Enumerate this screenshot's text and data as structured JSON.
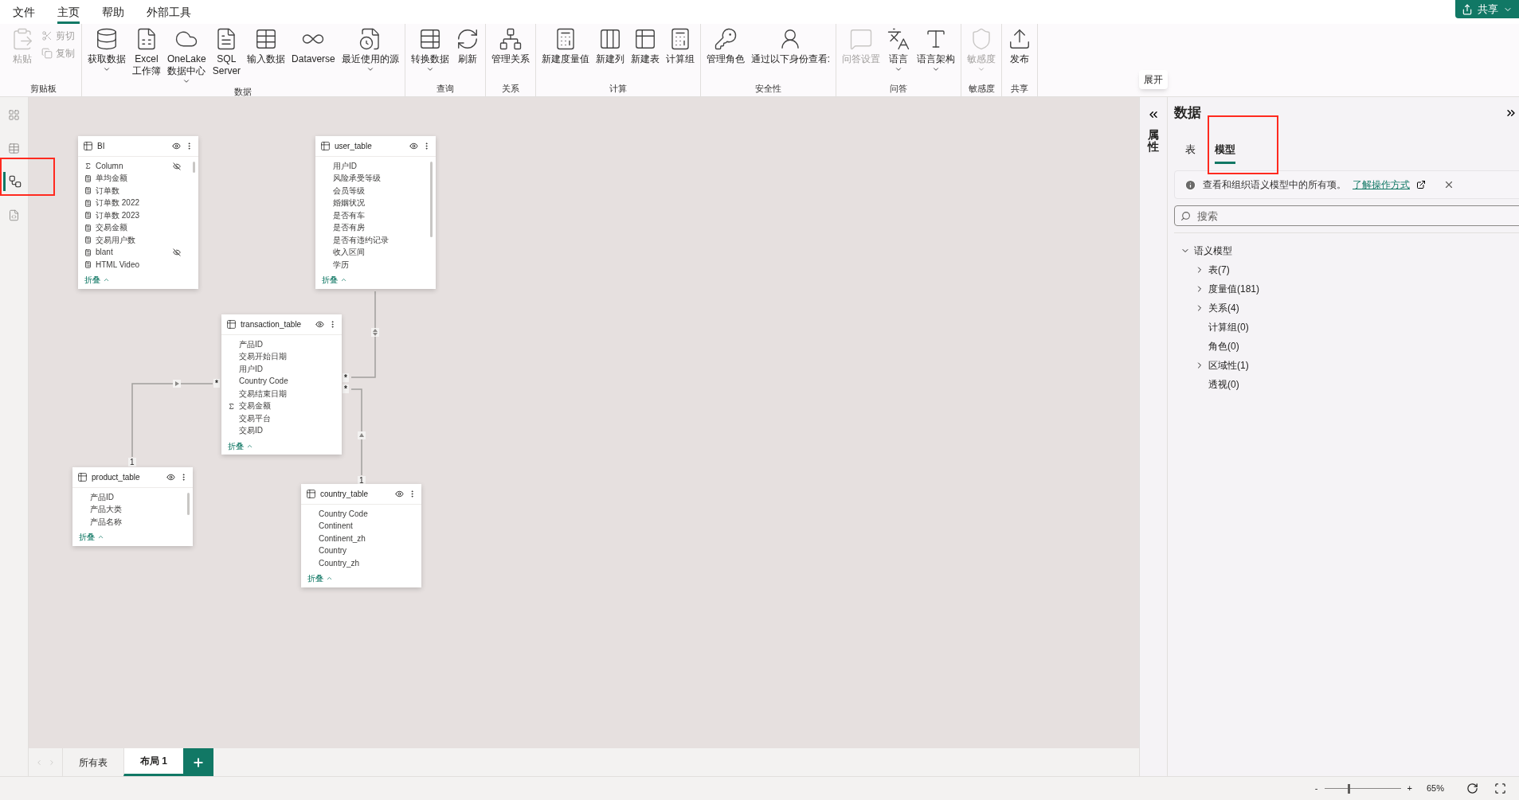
{
  "menu": {
    "tabs": [
      {
        "label": "文件",
        "selected": false
      },
      {
        "label": "主页",
        "selected": true
      },
      {
        "label": "帮助",
        "selected": false
      },
      {
        "label": "外部工具",
        "selected": false
      }
    ],
    "share": "共享"
  },
  "ribbon": {
    "groups": [
      {
        "label": "剪贴板",
        "buttons": [
          {
            "label": "粘贴",
            "kind": "large",
            "disabled": true,
            "dropdown": false
          },
          {
            "label": "剪切",
            "kind": "small",
            "disabled": true,
            "dropdown": false
          },
          {
            "label": "复制",
            "kind": "small",
            "disabled": true,
            "dropdown": false
          }
        ]
      },
      {
        "label": "数据",
        "buttons": [
          {
            "label": "获取数据",
            "kind": "large",
            "disabled": false,
            "dropdown": true
          },
          {
            "label": "Excel\n工作簿",
            "kind": "large",
            "disabled": false,
            "dropdown": false
          },
          {
            "label": "OneLake\n数据中心",
            "kind": "large",
            "disabled": false,
            "dropdown": true
          },
          {
            "label": "SQL\nServer",
            "kind": "large",
            "disabled": false,
            "dropdown": false
          },
          {
            "label": "输入数据",
            "kind": "large",
            "disabled": false,
            "dropdown": false
          },
          {
            "label": "Dataverse",
            "kind": "large",
            "disabled": false,
            "dropdown": false
          },
          {
            "label": "最近使用的源",
            "kind": "large",
            "disabled": false,
            "dropdown": true
          }
        ]
      },
      {
        "label": "查询",
        "buttons": [
          {
            "label": "转换数据",
            "kind": "large",
            "disabled": false,
            "dropdown": true
          },
          {
            "label": "刷新",
            "kind": "large",
            "disabled": false,
            "dropdown": false
          }
        ]
      },
      {
        "label": "关系",
        "buttons": [
          {
            "label": "管理关系",
            "kind": "large",
            "disabled": false,
            "dropdown": false
          }
        ]
      },
      {
        "label": "计算",
        "buttons": [
          {
            "label": "新建度量值",
            "kind": "large",
            "disabled": false,
            "dropdown": false
          },
          {
            "label": "新建列",
            "kind": "large",
            "disabled": false,
            "dropdown": false
          },
          {
            "label": "新建表",
            "kind": "large",
            "disabled": false,
            "dropdown": false
          },
          {
            "label": "计算组",
            "kind": "large",
            "disabled": false,
            "dropdown": false
          }
        ]
      },
      {
        "label": "安全性",
        "buttons": [
          {
            "label": "管理角色",
            "kind": "large",
            "disabled": false,
            "dropdown": false
          },
          {
            "label": "通过以下身份查看:",
            "kind": "large",
            "disabled": false,
            "dropdown": false
          }
        ]
      },
      {
        "label": "问答",
        "buttons": [
          {
            "label": "问答设置",
            "kind": "large",
            "disabled": true,
            "dropdown": false
          },
          {
            "label": "语言",
            "kind": "large",
            "disabled": false,
            "dropdown": true
          },
          {
            "label": "语言架构",
            "kind": "large",
            "disabled": false,
            "dropdown": true
          }
        ]
      },
      {
        "label": "敏感度",
        "buttons": [
          {
            "label": "敏感度",
            "kind": "large",
            "disabled": true,
            "dropdown": true
          }
        ]
      },
      {
        "label": "共享",
        "buttons": [
          {
            "label": "发布",
            "kind": "large",
            "disabled": false,
            "dropdown": false
          }
        ]
      }
    ]
  },
  "tooltip": "展开",
  "nav": [
    {
      "selected": false
    },
    {
      "selected": false
    },
    {
      "selected": true
    },
    {
      "selected": false
    }
  ],
  "tables": [
    {
      "name": "BI",
      "collapse": "折叠",
      "fields": [
        {
          "name": "Column",
          "kind": "sum",
          "hidden": true
        },
        {
          "name": "单均金额",
          "kind": "measure",
          "hidden": false
        },
        {
          "name": "订单数",
          "kind": "measure",
          "hidden": false
        },
        {
          "name": "订单数 2022",
          "kind": "measure",
          "hidden": false
        },
        {
          "name": "订单数 2023",
          "kind": "measure",
          "hidden": false
        },
        {
          "name": "交易金额",
          "kind": "measure",
          "hidden": false
        },
        {
          "name": "交易用户数",
          "kind": "measure",
          "hidden": false
        },
        {
          "name": "blant",
          "kind": "measure",
          "hidden": true
        },
        {
          "name": "HTML Video",
          "kind": "measure",
          "hidden": false
        }
      ]
    },
    {
      "name": "user_table",
      "collapse": "折叠",
      "fields": [
        {
          "name": "用户ID",
          "kind": "column",
          "hidden": false
        },
        {
          "name": "风险承受等级",
          "kind": "column",
          "hidden": false
        },
        {
          "name": "会员等级",
          "kind": "column",
          "hidden": false
        },
        {
          "name": "婚姻状况",
          "kind": "column",
          "hidden": false
        },
        {
          "name": "是否有车",
          "kind": "column",
          "hidden": false
        },
        {
          "name": "是否有房",
          "kind": "column",
          "hidden": false
        },
        {
          "name": "是否有违约记录",
          "kind": "column",
          "hidden": false
        },
        {
          "name": "收入区间",
          "kind": "column",
          "hidden": false
        },
        {
          "name": "学历",
          "kind": "column",
          "hidden": false
        }
      ]
    },
    {
      "name": "transaction_table",
      "collapse": "折叠",
      "fields": [
        {
          "name": "产品ID",
          "kind": "column",
          "hidden": false
        },
        {
          "name": "交易开始日期",
          "kind": "column",
          "hidden": false
        },
        {
          "name": "用户ID",
          "kind": "column",
          "hidden": false
        },
        {
          "name": "Country Code",
          "kind": "column",
          "hidden": false
        },
        {
          "name": "交易结束日期",
          "kind": "column",
          "hidden": false
        },
        {
          "name": "交易金额",
          "kind": "sum",
          "hidden": false
        },
        {
          "name": "交易平台",
          "kind": "column",
          "hidden": false
        },
        {
          "name": "交易ID",
          "kind": "column",
          "hidden": false
        }
      ]
    },
    {
      "name": "product_table",
      "collapse": "折叠",
      "fields": [
        {
          "name": "产品ID",
          "kind": "column",
          "hidden": false
        },
        {
          "name": "产品大类",
          "kind": "column",
          "hidden": false
        },
        {
          "name": "产品名称",
          "kind": "column",
          "hidden": false
        }
      ]
    },
    {
      "name": "country_table",
      "collapse": "折叠",
      "fields": [
        {
          "name": "Country Code",
          "kind": "column",
          "hidden": false
        },
        {
          "name": "Continent",
          "kind": "column",
          "hidden": false
        },
        {
          "name": "Continent_zh",
          "kind": "column",
          "hidden": false
        },
        {
          "name": "Country",
          "kind": "column",
          "hidden": false
        },
        {
          "name": "Country_zh",
          "kind": "column",
          "hidden": false
        }
      ]
    }
  ],
  "relationships": [
    {
      "one": "1",
      "many": "*"
    },
    {
      "many": "*"
    },
    {
      "one": "1",
      "many": "*"
    }
  ],
  "page_tabs": [
    {
      "label": "所有表",
      "selected": false
    },
    {
      "label": "布局 1",
      "selected": true
    }
  ],
  "properties_label": "属性",
  "data_pane": {
    "title": "数据",
    "tabs": [
      {
        "label": "表",
        "selected": false
      },
      {
        "label": "模型",
        "selected": true
      }
    ],
    "banner": {
      "text": "查看和组织语义模型中的所有项。",
      "link": "了解操作方式"
    },
    "search": {
      "placeholder": "搜索"
    },
    "tree": [
      {
        "label": "语义模型",
        "expanded": true,
        "children": [
          {
            "label": "表(7)",
            "kind": "folder",
            "expanded": false
          },
          {
            "label": "度量值(181)",
            "kind": "folder",
            "expanded": false
          },
          {
            "label": "关系(4)",
            "kind": "folder",
            "expanded": false
          },
          {
            "label": "计算组(0)",
            "kind": "leaf"
          },
          {
            "label": "角色(0)",
            "kind": "leaf"
          },
          {
            "label": "区域性(1)",
            "kind": "folder",
            "expanded": false
          },
          {
            "label": "透视(0)",
            "kind": "leaf"
          }
        ]
      }
    ]
  },
  "status": {
    "zoom": {
      "minus": "-",
      "plus": "+",
      "level": 0.31,
      "reading": "65%"
    }
  }
}
